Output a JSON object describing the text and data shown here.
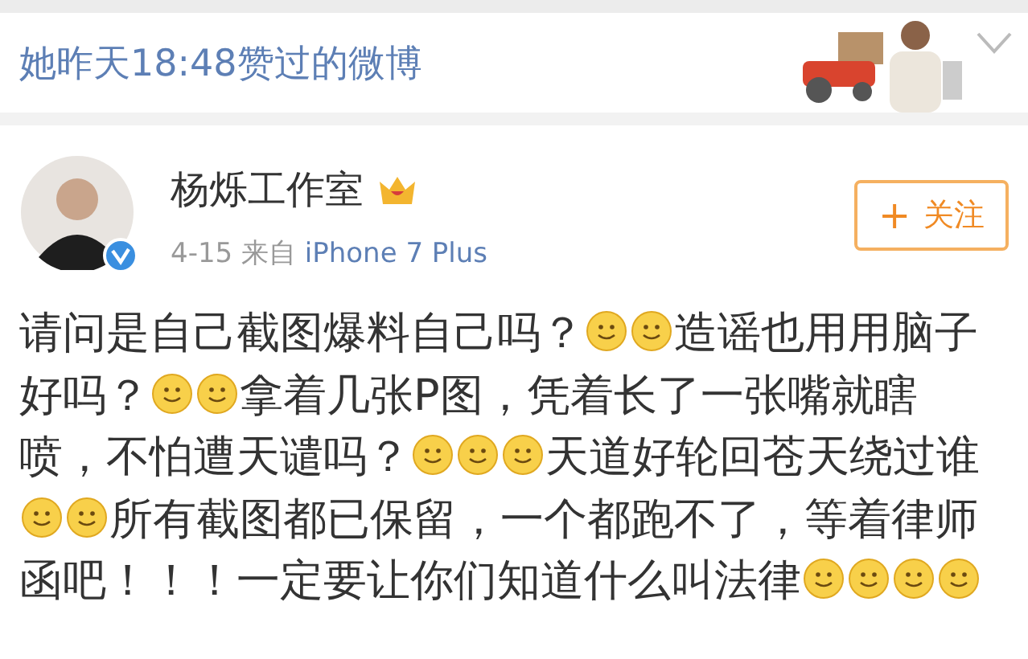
{
  "liked_banner": {
    "text": "她昨天18:48赞过的微博"
  },
  "post": {
    "author": "杨烁工作室",
    "verified": true,
    "date": "4-15",
    "source_prefix": "来自",
    "source": "iPhone 7 Plus",
    "follow_button": {
      "icon": "+",
      "label": "关注"
    },
    "lines": [
      [
        {
          "kind": "text",
          "text": "请问是自己截图爆料自己吗？"
        },
        {
          "kind": "emoji"
        },
        {
          "kind": "emoji"
        },
        {
          "kind": "text",
          "text": "造谣也用用脑子"
        }
      ],
      [
        {
          "kind": "text",
          "text": "好吗？"
        },
        {
          "kind": "emoji"
        },
        {
          "kind": "emoji"
        },
        {
          "kind": "text",
          "text": "拿着几张P图，凭着长了一张嘴就瞎"
        }
      ],
      [
        {
          "kind": "text",
          "text": "喷，不怕遭天谴吗？"
        },
        {
          "kind": "emoji"
        },
        {
          "kind": "emoji"
        },
        {
          "kind": "emoji"
        },
        {
          "kind": "text",
          "text": "天道好轮回苍天绕过谁"
        }
      ],
      [
        {
          "kind": "emoji"
        },
        {
          "kind": "emoji"
        },
        {
          "kind": "text",
          "text": "所有截图都已保留，一个都跑不了，等着律师"
        }
      ],
      [
        {
          "kind": "text",
          "text": "函吧！！！一定要让你们知道什么叫法律"
        },
        {
          "kind": "emoji"
        },
        {
          "kind": "emoji"
        },
        {
          "kind": "emoji"
        },
        {
          "kind": "emoji"
        }
      ]
    ]
  }
}
